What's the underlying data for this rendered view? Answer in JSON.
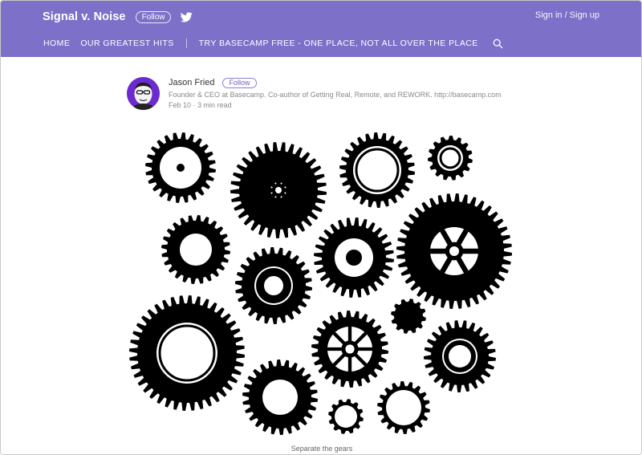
{
  "header": {
    "brand": "Signal v. Noise",
    "follow_label": "Follow",
    "signin_label": "Sign in / Sign up",
    "nav": [
      {
        "label": "HOME"
      },
      {
        "label": "OUR GREATEST HITS"
      },
      {
        "label": "TRY BASECAMP FREE - ONE PLACE, NOT ALL OVER THE PLACE"
      }
    ],
    "icons": [
      "twitter-icon",
      "search-icon"
    ],
    "background_color": "#7c70c8"
  },
  "author": {
    "name": "Jason Fried",
    "follow_label": "Follow",
    "bio": "Founder & CEO at Basecamp. Co-author of Getting Real, Remote, and REWORK. http://basecamp.com",
    "date": "Feb 10",
    "read_time": "3 min read",
    "avatar_color": "#6b2bd1"
  },
  "article": {
    "image_alt": "gears",
    "caption": "Separate the gears"
  }
}
